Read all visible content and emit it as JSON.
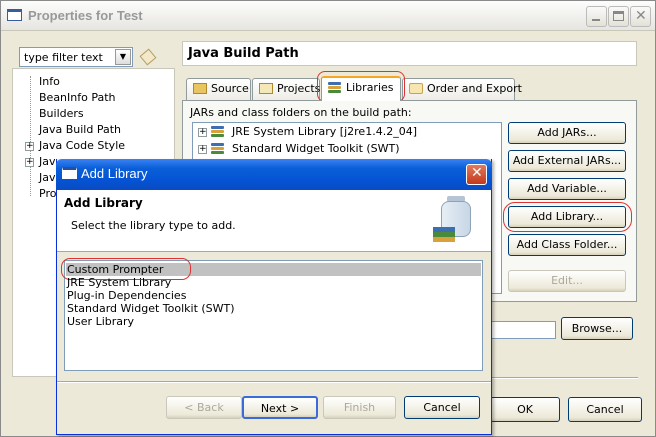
{
  "window": {
    "title": "Properties for Test"
  },
  "filter": {
    "value": "type filter text"
  },
  "tree": {
    "items": [
      {
        "label": "Info"
      },
      {
        "label": "BeanInfo Path"
      },
      {
        "label": "Builders"
      },
      {
        "label": "Java Build Path"
      },
      {
        "label": "Java Code Style"
      },
      {
        "label": "Java"
      },
      {
        "label": "Jav"
      },
      {
        "label": "Pro"
      }
    ]
  },
  "page": {
    "title": "Java Build Path",
    "tabs": [
      {
        "label": "Source"
      },
      {
        "label": "Projects"
      },
      {
        "label": "Libraries"
      },
      {
        "label": "Order and Export"
      }
    ],
    "jars_label": "JARs and class folders on the build path:",
    "entries": [
      {
        "label": "JRE System Library [j2re1.4.2_04]"
      },
      {
        "label": "Standard Widget Toolkit (SWT)"
      }
    ],
    "buttons": {
      "add_jars": "Add JARs...",
      "add_external_jars": "Add External JARs...",
      "add_variable": "Add Variable...",
      "add_library": "Add Library...",
      "add_class_folder": "Add Class Folder...",
      "edit": "Edit...",
      "browse": "Browse..."
    }
  },
  "footer": {
    "ok": "OK",
    "cancel": "Cancel"
  },
  "dialog": {
    "title": "Add Library",
    "heading": "Add Library",
    "description": "Select the library type to add.",
    "items": [
      {
        "label": "Custom Prompter"
      },
      {
        "label": "JRE System Library"
      },
      {
        "label": "Plug-in Dependencies"
      },
      {
        "label": "Standard Widget Toolkit (SWT)"
      },
      {
        "label": "User Library"
      }
    ],
    "buttons": {
      "back": "< Back",
      "next": "Next >",
      "finish": "Finish",
      "cancel": "Cancel"
    }
  }
}
